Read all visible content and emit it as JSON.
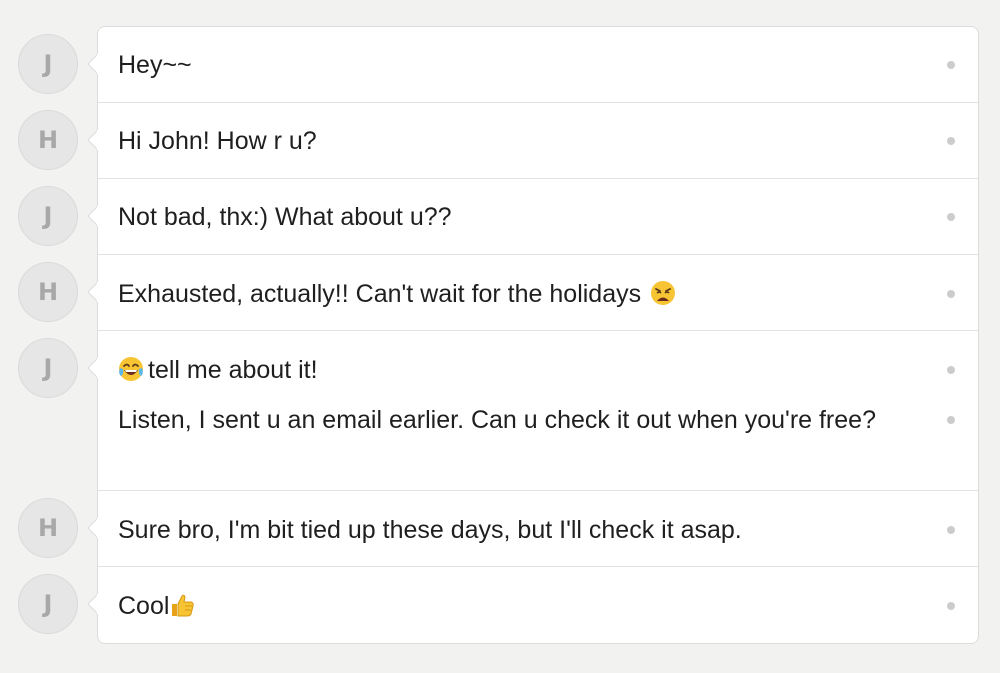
{
  "messages": [
    {
      "sender_initial": "J",
      "text": "Hey~~",
      "emoji_after": ""
    },
    {
      "sender_initial": "H",
      "text": "Hi John! How r u?",
      "emoji_after": ""
    },
    {
      "sender_initial": "J",
      "text": "Not bad, thx:) What about u??",
      "emoji_after": ""
    },
    {
      "sender_initial": "H",
      "text": "Exhausted, actually!! Can't wait for the holidays",
      "emoji_after": "weary-face-icon"
    },
    {
      "sender_initial": "J",
      "lines": [
        {
          "emoji_before": "tears-of-joy-icon",
          "text": "tell me about it!"
        },
        {
          "text": "Listen, I sent u an email earlier. Can u check it out when you're free?"
        }
      ]
    },
    {
      "sender_initial": "H",
      "text": "Sure bro, I'm bit tied up these days, but I'll check it asap.",
      "emoji_after": ""
    },
    {
      "sender_initial": "J",
      "text": "Cool",
      "emoji_after": "thumbs-up-icon"
    }
  ],
  "colors": {
    "background": "#f2f2f1",
    "card": "#ffffff",
    "avatar_bg": "#e6e6e6",
    "avatar_text": "#a8a8a8",
    "text": "#1f1f1f",
    "status_dot": "#cccccc"
  }
}
